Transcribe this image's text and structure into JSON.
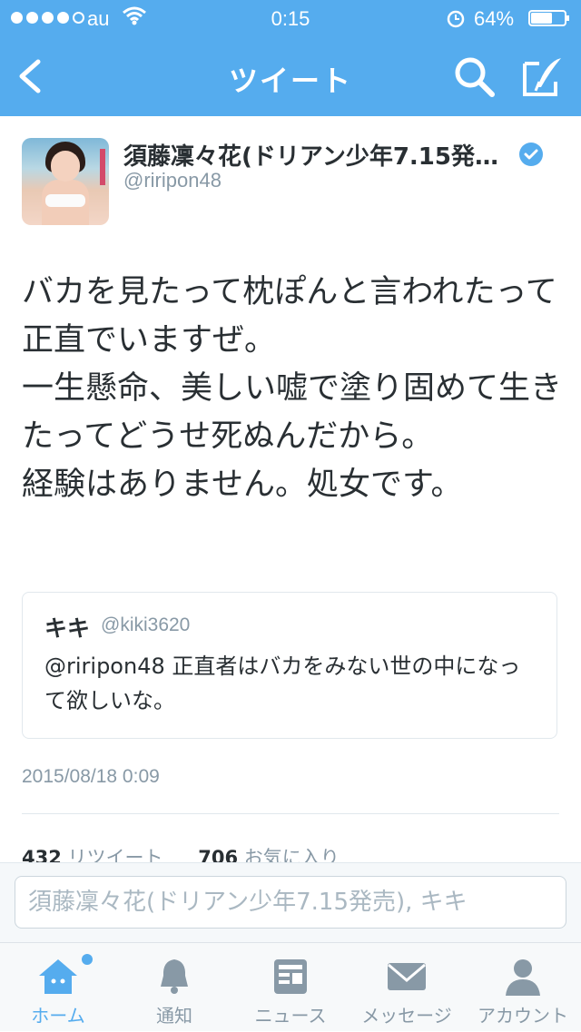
{
  "status_bar": {
    "carrier": "au",
    "time": "0:15",
    "battery_percent": "64%",
    "battery_level": 0.64
  },
  "nav": {
    "title": "ツイート",
    "icons": [
      "back-arrow-icon",
      "search-icon",
      "compose-icon"
    ]
  },
  "tweet": {
    "author_name": "須藤凜々花(ドリアン少年7.15発…",
    "author_handle": "@riripon48",
    "verified": true,
    "text_paragraphs": [
      "バカを見たって枕ぽんと言われたって正直でいますぜ。",
      "一生懸命、美しい嘘で塗り固めて生きたってどうせ死ぬんだから。",
      "経験はありません。処女です。"
    ],
    "timestamp": "2015/08/18 0:09",
    "retweet_count": "432",
    "retweet_label": "リツイート",
    "favorite_count": "706",
    "favorite_label": "お気に入り"
  },
  "quoted_tweet": {
    "name": "キキ",
    "handle": "@kiki3620",
    "text": "@riripon48 正直者はバカをみない世の中になって欲しいな。"
  },
  "reply": {
    "placeholder": "須藤凜々花(ドリアン少年7.15発売), キキ"
  },
  "tabs": [
    {
      "label": "ホーム",
      "icon": "home-icon",
      "active": true
    },
    {
      "label": "通知",
      "icon": "bell-icon",
      "active": false
    },
    {
      "label": "ニュース",
      "icon": "news-icon",
      "active": false
    },
    {
      "label": "メッセージ",
      "icon": "envelope-icon",
      "active": false
    },
    {
      "label": "アカウント",
      "icon": "person-icon",
      "active": false
    }
  ],
  "colors": {
    "brand_blue": "#55acee",
    "text": "#292f33",
    "muted": "#8899a6"
  }
}
